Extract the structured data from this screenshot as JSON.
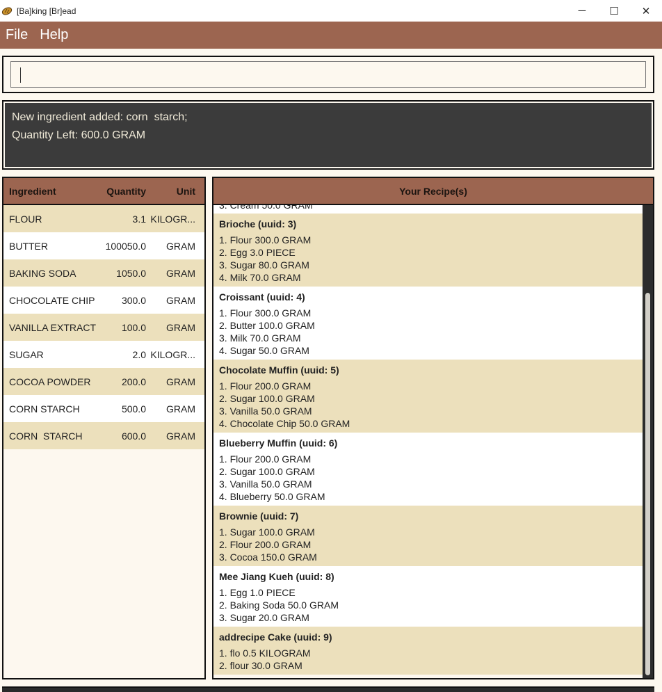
{
  "window": {
    "title": "[Ba]king [Br]ead",
    "minimize_icon": "─",
    "maximize_icon": "☐",
    "close_icon": "✕"
  },
  "menu": {
    "file_label": "File",
    "help_label": "Help"
  },
  "command": {
    "value": ""
  },
  "result": {
    "line1": "New ingredient added: corn  starch;",
    "line2": "Quantity Left: 600.0 GRAM"
  },
  "ingredients": {
    "headers": {
      "name": "Ingredient",
      "quantity": "Quantity",
      "unit": "Unit"
    },
    "rows": [
      {
        "name": "FLOUR",
        "quantity": "3.1",
        "unit": "KILOGR..."
      },
      {
        "name": "BUTTER",
        "quantity": "100050.0",
        "unit": "GRAM"
      },
      {
        "name": "BAKING SODA",
        "quantity": "1050.0",
        "unit": "GRAM"
      },
      {
        "name": "CHOCOLATE CHIP",
        "quantity": "300.0",
        "unit": "GRAM"
      },
      {
        "name": "VANILLA EXTRACT",
        "quantity": "100.0",
        "unit": "GRAM"
      },
      {
        "name": "SUGAR",
        "quantity": "2.0",
        "unit": "KILOGR..."
      },
      {
        "name": "COCOA POWDER",
        "quantity": "200.0",
        "unit": "GRAM"
      },
      {
        "name": "CORN STARCH",
        "quantity": "500.0",
        "unit": "GRAM"
      },
      {
        "name": "CORN  STARCH",
        "quantity": "600.0",
        "unit": "GRAM"
      }
    ]
  },
  "recipes": {
    "header": "Your Recipe(s)",
    "partial_line": "3. Cream 50.0 GRAM",
    "items": [
      {
        "title": "Brioche (uuid: 3)",
        "steps": [
          "1. Flour 300.0 GRAM",
          "2. Egg 3.0 PIECE",
          "3. Sugar 80.0 GRAM",
          "4. Milk 70.0 GRAM"
        ]
      },
      {
        "title": "Croissant (uuid: 4)",
        "steps": [
          "1. Flour 300.0 GRAM",
          "2. Butter 100.0 GRAM",
          "3. Milk 70.0 GRAM",
          "4. Sugar 50.0 GRAM"
        ]
      },
      {
        "title": "Chocolate Muffin (uuid: 5)",
        "steps": [
          "1. Flour 200.0 GRAM",
          "2. Sugar 100.0 GRAM",
          "3. Vanilla 50.0 GRAM",
          "4. Chocolate Chip 50.0 GRAM"
        ]
      },
      {
        "title": "Blueberry Muffin (uuid: 6)",
        "steps": [
          "1. Flour 200.0 GRAM",
          "2. Sugar 100.0 GRAM",
          "3. Vanilla 50.0 GRAM",
          "4. Blueberry 50.0 GRAM"
        ]
      },
      {
        "title": "Brownie (uuid: 7)",
        "steps": [
          "1. Sugar 100.0 GRAM",
          "2. Flour 200.0 GRAM",
          "3. Cocoa 150.0 GRAM"
        ]
      },
      {
        "title": "Mee Jiang Kueh (uuid: 8)",
        "steps": [
          "1. Egg 1.0 PIECE",
          "2. Baking Soda 50.0 GRAM",
          "3. Sugar 20.0 GRAM"
        ]
      },
      {
        "title": "addrecipe Cake (uuid: 9)",
        "steps": [
          "1. flo 0.5 KILOGRAM",
          "2. flour 30.0 GRAM"
        ]
      }
    ]
  }
}
